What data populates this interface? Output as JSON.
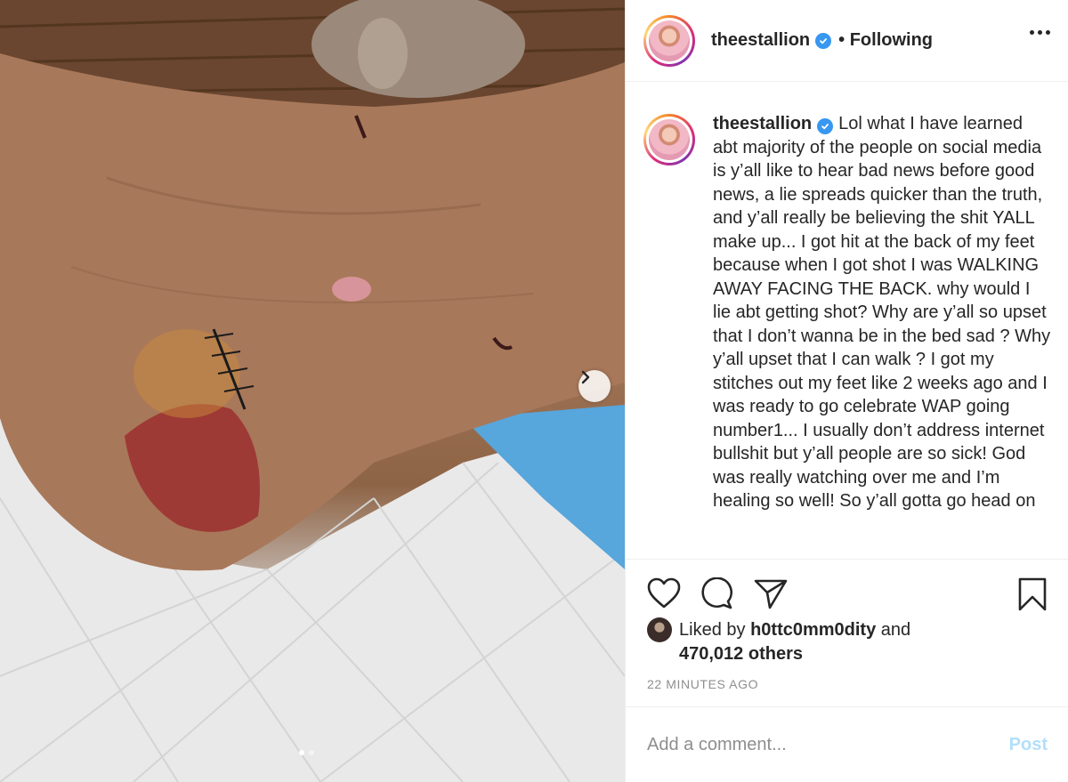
{
  "post": {
    "username": "theestallion",
    "verified": true,
    "follow_status": "Following",
    "caption": "Lol what I have learned abt majority of the people on social media is y’all like to hear bad news before good news, a lie spreads quicker than the truth, and y’all really be believing the shit YALL make up... I got hit at the back of my feet because when I got shot I was WALKING AWAY FACING THE BACK. why would I lie abt getting shot? Why are y’all so upset that I don’t wanna be in the bed sad ? Why y’all upset that I can walk ? I got my stitches out my feet like 2 weeks ago and I was ready to go celebrate WAP going number1... I usually don’t address internet bullshit but y’all people are so sick! God was really watching over me and I’m healing so well! So y’all gotta go head on",
    "liked_by_prefix": "Liked by",
    "liked_by_user": "h0ttc0mm0dity",
    "liked_by_and": "and",
    "likes_others": "470,012 others",
    "timestamp": "22 MINUTES AGO"
  },
  "carousel": {
    "total": 2,
    "current": 1
  },
  "comment": {
    "placeholder": "Add a comment...",
    "post_label": "Post"
  },
  "icons": {
    "more": "more-options-icon",
    "verified": "verified-badge-icon",
    "next": "chevron-right-icon",
    "like": "heart-icon",
    "comment": "comment-bubble-icon",
    "share": "paper-plane-icon",
    "save": "bookmark-icon"
  },
  "colors": {
    "verified": "#3897f0",
    "post_disabled": "#b2dffc",
    "muted": "#8e8e8e",
    "text": "#262626"
  }
}
